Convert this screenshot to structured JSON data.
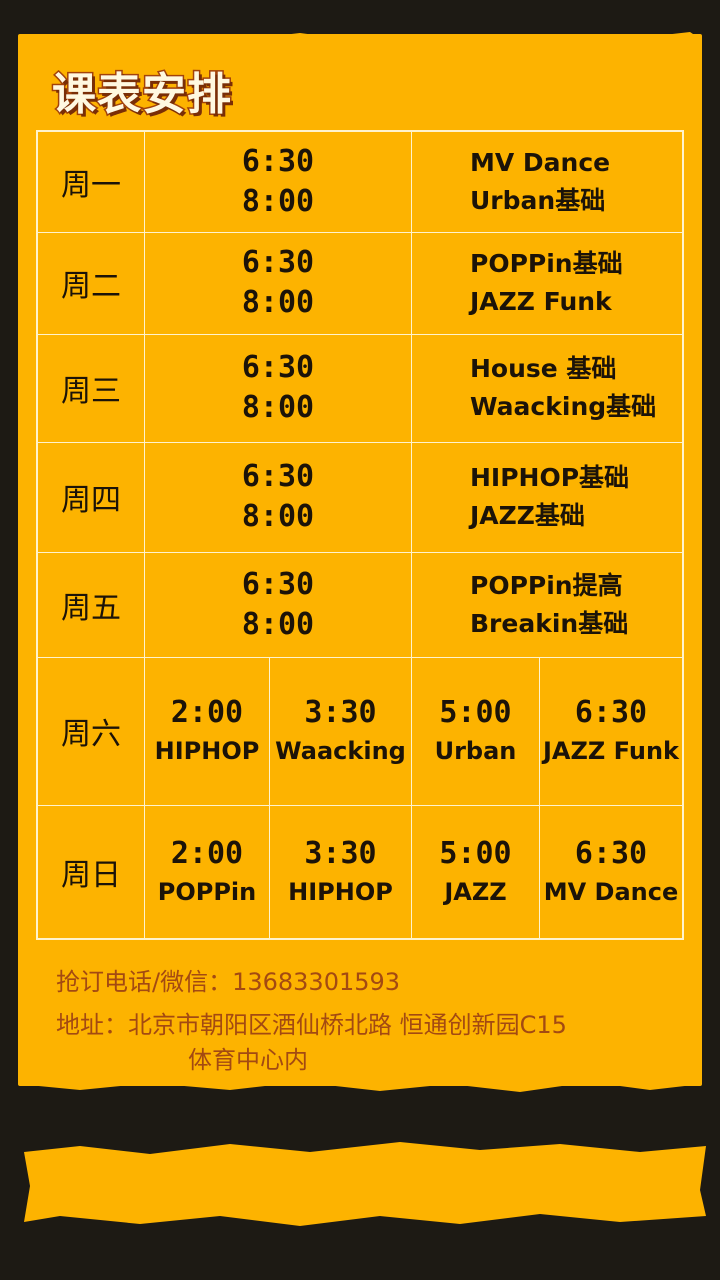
{
  "title": "课表安排",
  "weekday_rows": [
    {
      "day": "周一",
      "time_start": "6:30",
      "time_end": "8:00",
      "course_1": "MV Dance",
      "course_2": "Urban基础"
    },
    {
      "day": "周二",
      "time_start": "6:30",
      "time_end": "8:00",
      "course_1": "POPPin基础",
      "course_2": "JAZZ Funk"
    },
    {
      "day": "周三",
      "time_start": "6:30",
      "time_end": "8:00",
      "course_1": "House 基础",
      "course_2": "Waacking基础"
    },
    {
      "day": "周四",
      "time_start": "6:30",
      "time_end": "8:00",
      "course_1": "HIPHOP基础",
      "course_2": "JAZZ基础"
    },
    {
      "day": "周五",
      "time_start": "6:30",
      "time_end": "8:00",
      "course_1": "POPPin提高",
      "course_2": "Breakin基础"
    }
  ],
  "weekend_rows": [
    {
      "day": "周六",
      "slots": [
        {
          "time": "2:00",
          "course": "HIPHOP"
        },
        {
          "time": "3:30",
          "course": "Waacking"
        },
        {
          "time": "5:00",
          "course": "Urban"
        },
        {
          "time": "6:30",
          "course": "JAZZ Funk"
        }
      ]
    },
    {
      "day": "周日",
      "slots": [
        {
          "time": "2:00",
          "course": "POPPin"
        },
        {
          "time": "3:30",
          "course": "HIPHOP"
        },
        {
          "time": "5:00",
          "course": "JAZZ"
        },
        {
          "time": "6:30",
          "course": "MV Dance"
        }
      ]
    }
  ],
  "contact": {
    "phone_line": "抢订电话/微信：13683301593",
    "address_line1": "地址：北京市朝阳区酒仙桥北路 恒通创新园C15",
    "address_line2": "体育中心内"
  },
  "colors": {
    "background": "#1d1a14",
    "panel": "#fdb300",
    "title_outline": "#a3420a",
    "info_text": "#a34a12"
  }
}
